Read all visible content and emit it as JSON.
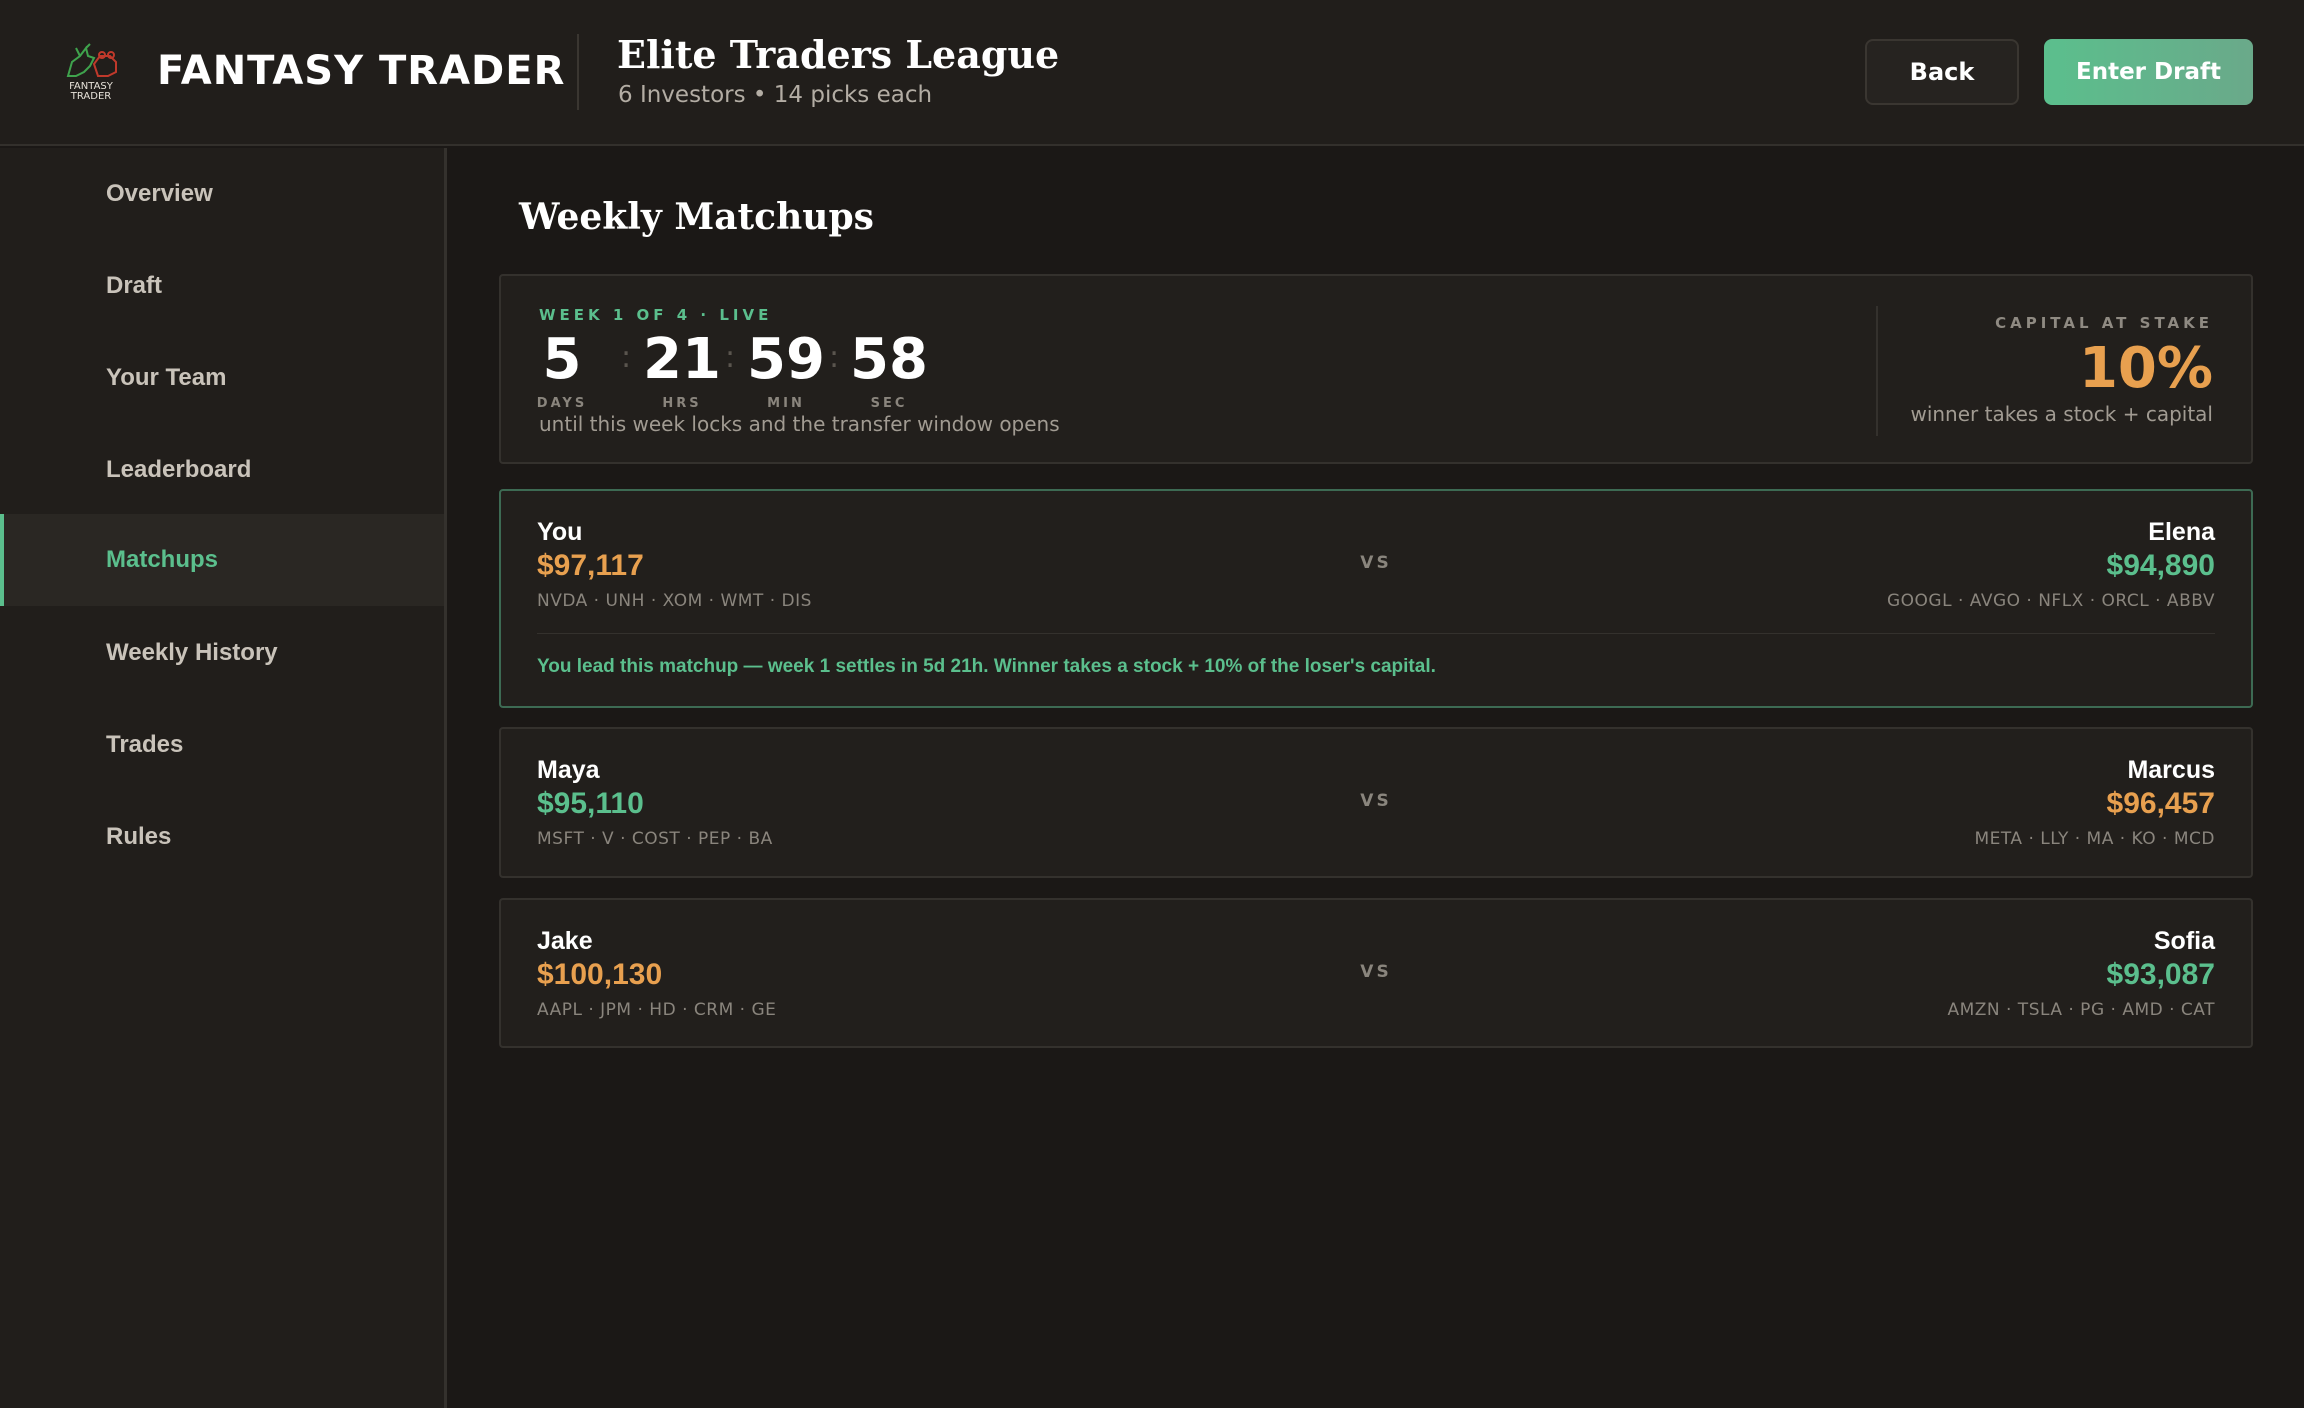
{
  "header": {
    "logo_text": "FANTASY TRADER",
    "brand": "FANTASY TRADER",
    "league_title": "Elite Traders League",
    "league_sub": "6 Investors • 14 picks each",
    "back_label": "Back",
    "enter_label": "Enter Draft"
  },
  "sidebar": {
    "items": [
      {
        "label": "Overview"
      },
      {
        "label": "Draft"
      },
      {
        "label": "Your Team"
      },
      {
        "label": "Leaderboard"
      },
      {
        "label": "Matchups",
        "active": true
      },
      {
        "label": "Weekly History"
      },
      {
        "label": "Trades"
      },
      {
        "label": "Rules"
      }
    ]
  },
  "main": {
    "title": "Weekly Matchups",
    "countdown": {
      "week_label": "WEEK 1 OF 4 · LIVE",
      "days": "5",
      "days_label": "DAYS",
      "hrs": "21",
      "hrs_label": "HRS",
      "min": "59",
      "min_label": "MIN",
      "sec": "58",
      "sec_label": "SEC",
      "sep": ":",
      "note": "until this week locks and the transfer window opens",
      "stake_label": "CAPITAL AT STAKE",
      "stake_value": "10%",
      "stake_note": "winner takes a stock + capital"
    },
    "vs": "VS",
    "matchups": [
      {
        "left": {
          "name": "You",
          "value": "$97,117",
          "tickers": "NVDA · UNH · XOM · WMT · DIS"
        },
        "right": {
          "name": "Elena",
          "value": "$94,890",
          "tickers": "GOOGL · AVGO · NFLX · ORCL · ABBV"
        },
        "note": "You lead this matchup — week 1 settles in 5d 21h. Winner takes a stock + 10% of the loser's capital."
      },
      {
        "left": {
          "name": "Maya",
          "value": "$95,110",
          "tickers": "MSFT · V · COST · PEP · BA"
        },
        "right": {
          "name": "Marcus",
          "value": "$96,457",
          "tickers": "META · LLY · MA · KO · MCD"
        }
      },
      {
        "left": {
          "name": "Jake",
          "value": "$100,130",
          "tickers": "AAPL · JPM · HD · CRM · GE"
        },
        "right": {
          "name": "Sofia",
          "value": "$93,087",
          "tickers": "AMZN · TSLA · PG · AMD · CAT"
        }
      }
    ]
  },
  "colors": {
    "accent_green": "#5bbf8d",
    "accent_gold": "#e8a04f",
    "logo_bull": "#3fa34d",
    "logo_bear": "#c0392b"
  }
}
